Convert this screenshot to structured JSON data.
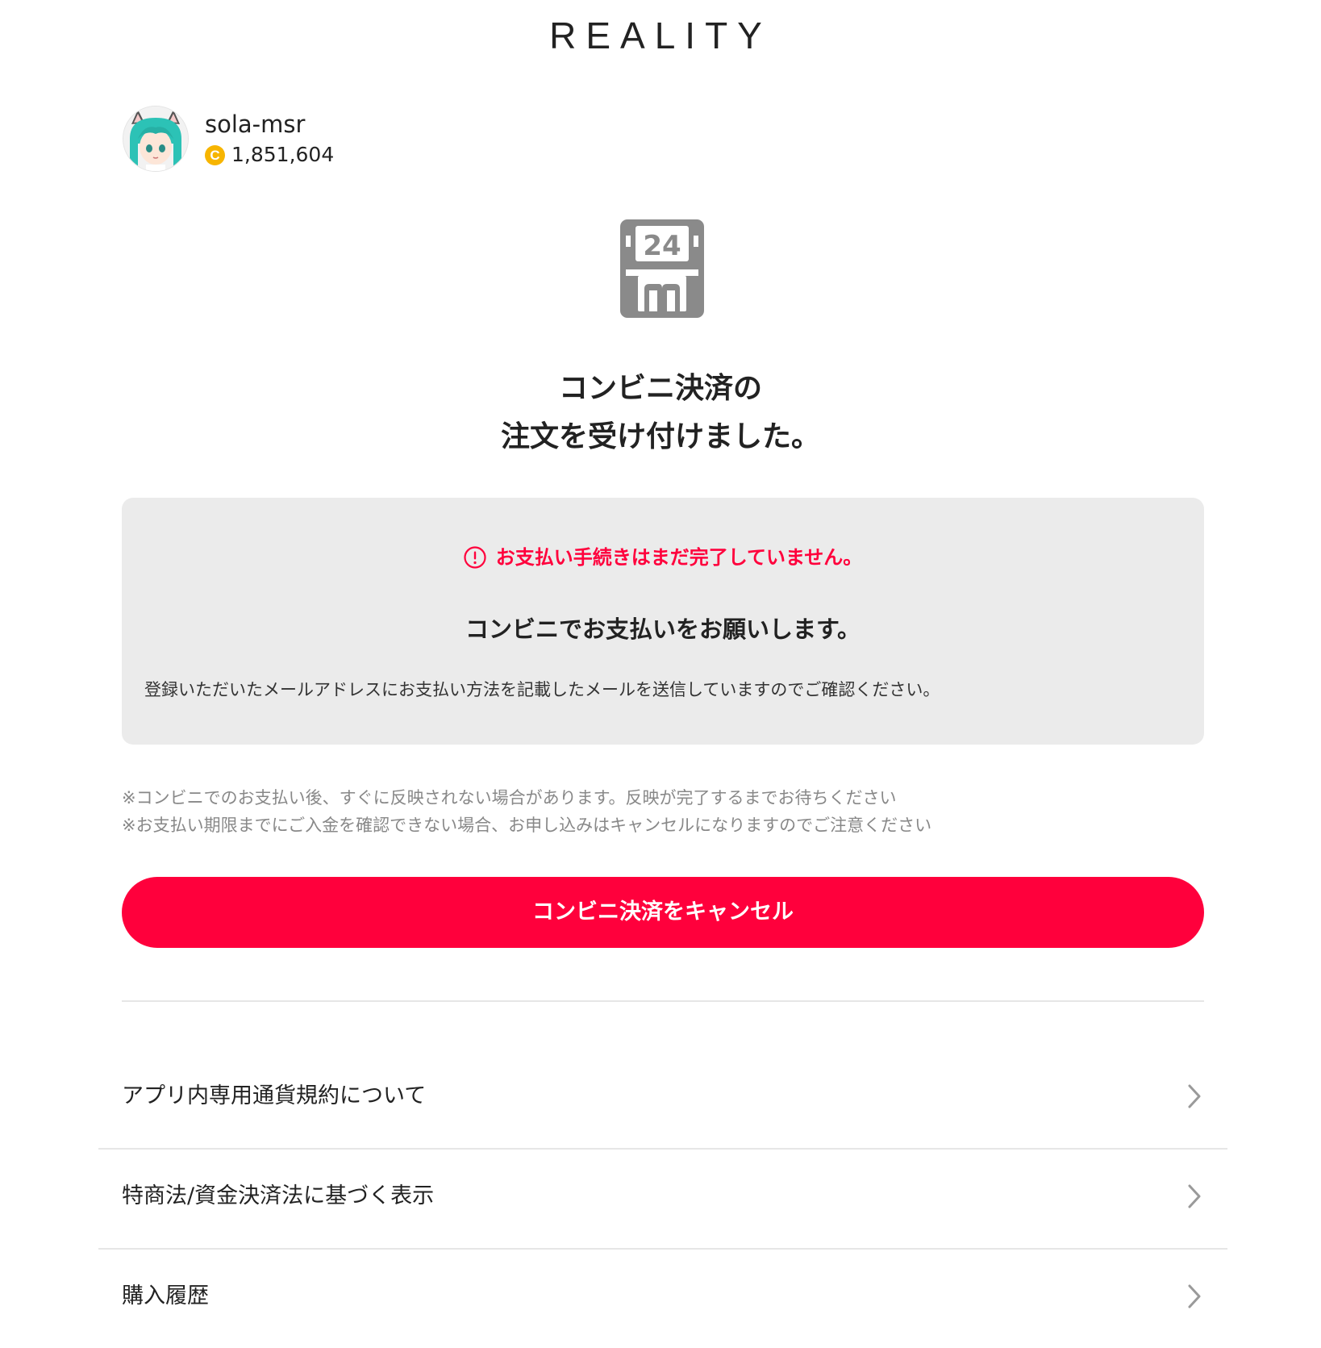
{
  "header": {
    "logo_text": "REALITY"
  },
  "user": {
    "name": "sola-msr",
    "coin_symbol": "C",
    "coin_balance": "1,851,604",
    "coin_color": "#f7b500"
  },
  "status": {
    "icon": "convenience-store-24h-icon",
    "headline_line1": "コンビニ決済の",
    "headline_line2": "注文を受け付けました。"
  },
  "notice": {
    "warning_icon": "exclamation-circle-icon",
    "warning_text": "お支払い手続きはまだ完了していません。",
    "warning_color": "#ff003c",
    "title": "コンビニでお支払いをお願いします。",
    "description": "登録いただいたメールアドレスにお支払い方法を記載したメールを送信していますのでご確認ください。"
  },
  "notes": [
    "※コンビニでのお支払い後、すぐに反映されない場合があります。反映が完了するまでお待ちください",
    "※お支払い期限までにご入金を確認できない場合、お申し込みはキャンセルになりますのでご注意ください"
  ],
  "actions": {
    "cancel_label": "コンビニ決済をキャンセル",
    "cancel_color": "#ff003c"
  },
  "menu": {
    "items": [
      {
        "label": "アプリ内専用通貨規約について",
        "icon": "chevron-right-icon"
      },
      {
        "label": "特商法/資金決済法に基づく表示",
        "icon": "chevron-right-icon"
      },
      {
        "label": "購入履歴",
        "icon": "chevron-right-icon"
      }
    ]
  }
}
